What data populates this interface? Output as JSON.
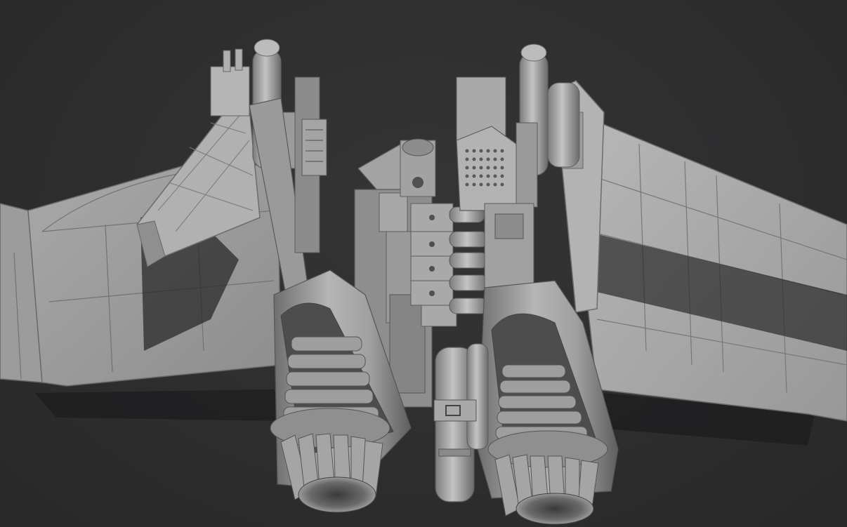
{
  "scene": {
    "subject": "gray-clay-aircraft-model",
    "colors": {
      "background": "#2e2e2f",
      "shadow": "#1f1f20",
      "clay_light": "#bdbdbd",
      "clay_mid": "#9a9a9a",
      "clay_dark": "#6d6d6d",
      "clay_deep": "#4a4a4a"
    }
  }
}
